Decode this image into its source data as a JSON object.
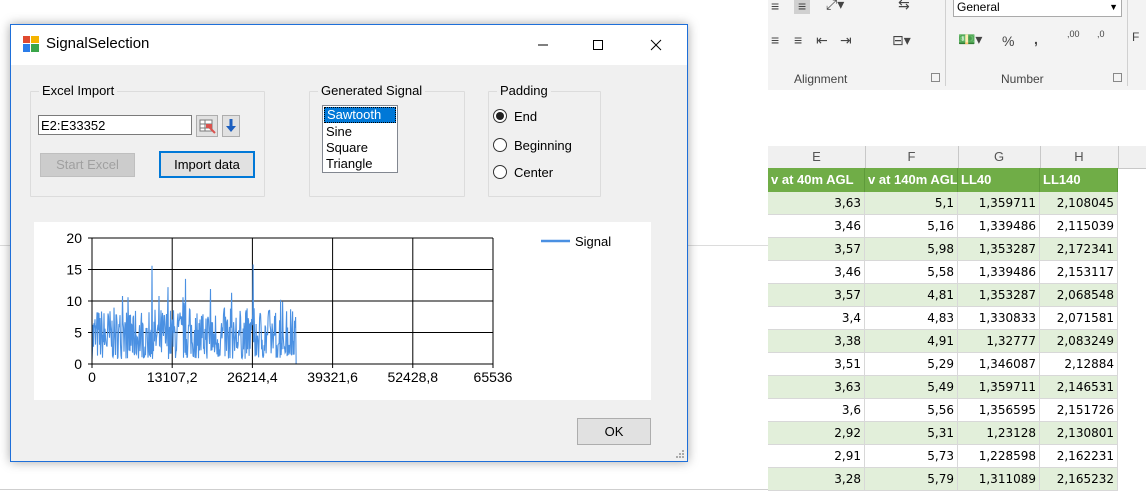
{
  "excel": {
    "number_format": "General",
    "groups": [
      "Alignment",
      "Number"
    ],
    "ribbon_glyphs": {
      "percent": "%",
      "comma": ",",
      "increase_decimal": ",00",
      "decrease_decimal": ",0"
    },
    "partial_label": "F",
    "columns": [
      "E",
      "F",
      "G",
      "H"
    ],
    "header_cells": [
      "v at 40m AGL",
      "v at 140m AGL",
      "LL40",
      "LL140"
    ],
    "rows": [
      [
        "3,63",
        "5,1",
        "1,359711",
        "2,108045"
      ],
      [
        "3,46",
        "5,16",
        "1,339486",
        "2,115039"
      ],
      [
        "3,57",
        "5,98",
        "1,353287",
        "2,172341"
      ],
      [
        "3,46",
        "5,58",
        "1,339486",
        "2,153117"
      ],
      [
        "3,57",
        "4,81",
        "1,353287",
        "2,068548"
      ],
      [
        "3,4",
        "4,83",
        "1,330833",
        "2,071581"
      ],
      [
        "3,38",
        "4,91",
        "1,32777",
        "2,083249"
      ],
      [
        "3,51",
        "5,29",
        "1,346087",
        "2,12884"
      ],
      [
        "3,63",
        "5,49",
        "1,359711",
        "2,146531"
      ],
      [
        "3,6",
        "5,56",
        "1,356595",
        "2,151726"
      ],
      [
        "2,92",
        "5,31",
        "1,23128",
        "2,130801"
      ],
      [
        "2,91",
        "5,73",
        "1,228598",
        "2,162231"
      ],
      [
        "3,28",
        "5,79",
        "1,311089",
        "2,165232"
      ]
    ]
  },
  "dialog": {
    "title": "SignalSelection",
    "excel_import": {
      "label": "Excel Import",
      "range_value": "E2:E33352",
      "start_excel_label": "Start Excel",
      "import_label": "Import data"
    },
    "generated_signal": {
      "label": "Generated Signal",
      "items": [
        "Sawtooth",
        "Sine",
        "Square",
        "Triangle"
      ],
      "selected": "Sawtooth"
    },
    "padding": {
      "label": "Padding",
      "options": [
        "End",
        "Beginning",
        "Center"
      ],
      "selected": "End"
    },
    "ok_label": "OK"
  },
  "chart_data": {
    "type": "line",
    "title": "",
    "xlabel": "",
    "ylabel": "",
    "xlim": [
      0,
      65536
    ],
    "ylim": [
      0,
      20
    ],
    "x_ticks": [
      "0",
      "13107,2",
      "26214,4",
      "39321,6",
      "52428,8",
      "65536"
    ],
    "y_ticks": [
      "0",
      "5",
      "10",
      "15",
      "20"
    ],
    "grid": true,
    "legend": "top-right",
    "series": [
      {
        "name": "Signal",
        "color": "#4a90e2",
        "segments": [
          {
            "x_range": [
              0,
              33352
            ],
            "y_range": [
              0.5,
              15.8
            ],
            "typical": [
              0.8,
              9
            ]
          },
          {
            "x_range": [
              33352,
              65536
            ],
            "y_const": 0
          }
        ],
        "spikes": [
          [
            9800,
            15.6
          ],
          [
            26300,
            15.8
          ],
          [
            15300,
            13.5
          ],
          [
            12400,
            12.2
          ],
          [
            22800,
            11.3
          ],
          [
            30800,
            10.2
          ],
          [
            5000,
            10.8
          ],
          [
            19400,
            11.9
          ]
        ]
      }
    ]
  }
}
